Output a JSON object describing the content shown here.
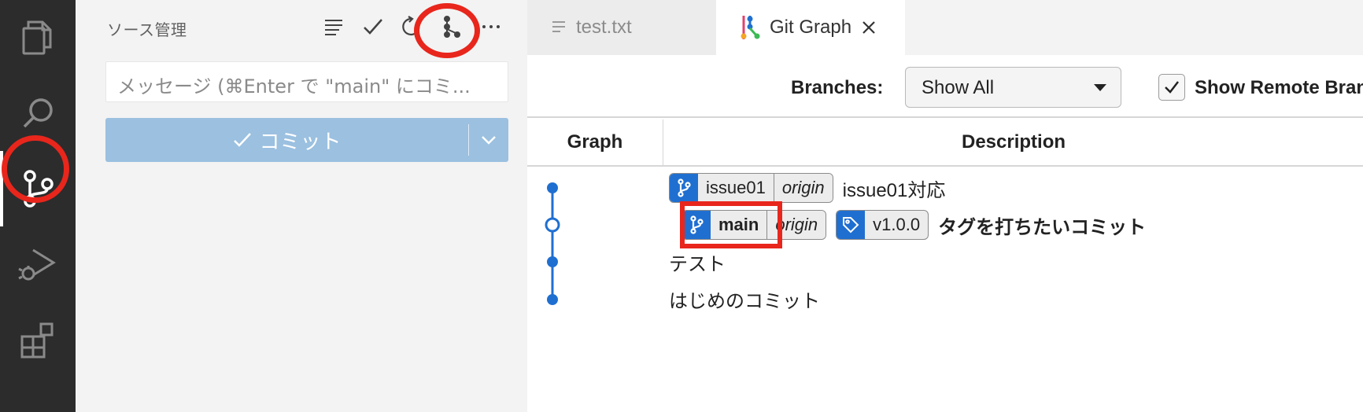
{
  "sidebar": {
    "title": "ソース管理",
    "commit_placeholder": "メッセージ (⌘Enter で \"main\" にコミ...",
    "commit_label": "コミット"
  },
  "tabs": [
    {
      "label": "test.txt",
      "icon": "lines-icon"
    },
    {
      "label": "Git Graph",
      "icon": "git-graph-icon"
    }
  ],
  "filter": {
    "branches_label": "Branches:",
    "branches_value": "Show All",
    "remote_label": "Show Remote Branches",
    "remote_checked": true
  },
  "table": {
    "col_graph": "Graph",
    "col_desc": "Description",
    "rows": [
      {
        "branch": "issue01",
        "remote": "origin",
        "message": "issue01対応"
      },
      {
        "branch": "main",
        "remote": "origin",
        "tag": "v1.0.0",
        "message": "タグを打ちたいコミット"
      },
      {
        "message": "テスト"
      },
      {
        "message": "はじめのコミット"
      }
    ]
  },
  "colors": {
    "accent": "#1f6fd1",
    "highlight": "#e8261c",
    "activity_bg": "#2c2c2c"
  }
}
